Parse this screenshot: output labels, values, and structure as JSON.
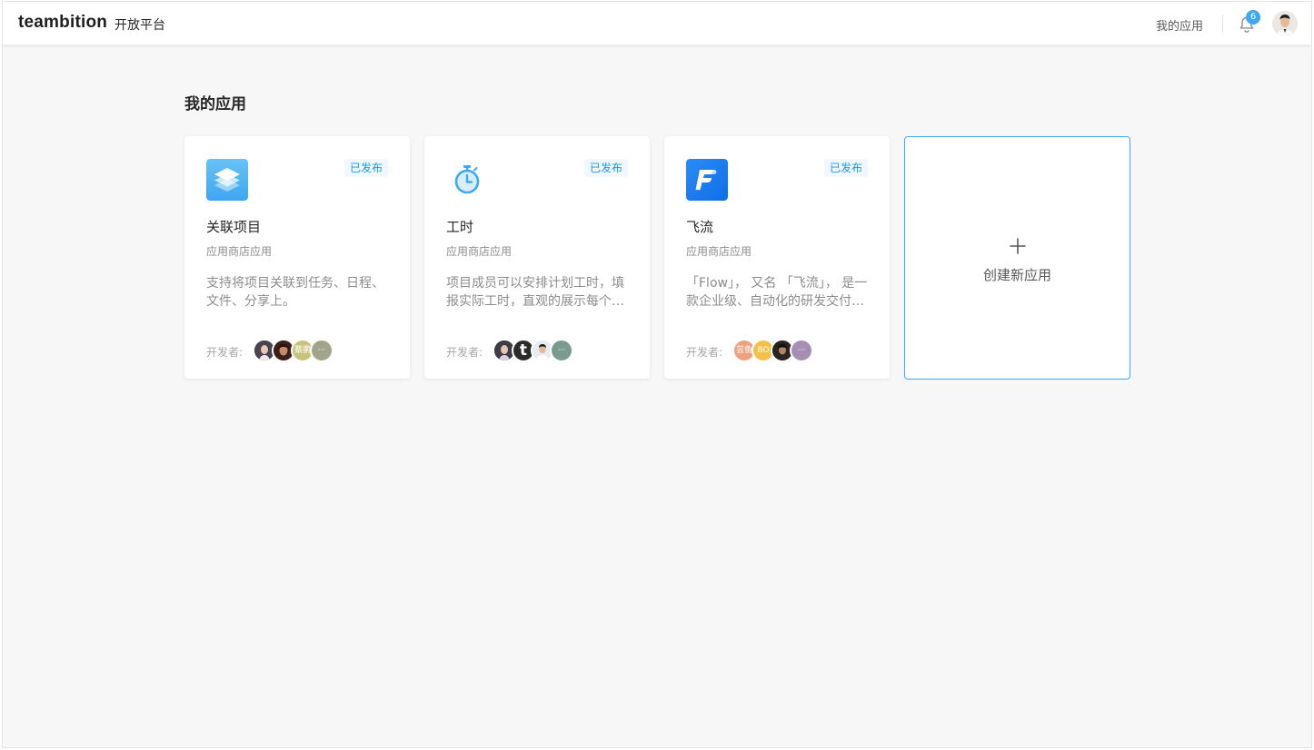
{
  "header": {
    "brand": "teambition",
    "brand_sub": "开放平台",
    "nav_my_apps": "我的应用",
    "notification_count": "6",
    "icons": {
      "bell": "bell-icon",
      "user": "user-avatar"
    }
  },
  "main": {
    "title": "我的应用",
    "dev_label": "开发者:",
    "cards": [
      {
        "icon": "layers-icon",
        "status": "已发布",
        "name": "关联项目",
        "type": "应用商店应用",
        "desc": "支持将项目关联到任务、日程、文件、分享上。",
        "devs": [
          {
            "text": "",
            "color": "#4a4350"
          },
          {
            "text": "",
            "color": "#7a3b2e"
          },
          {
            "text": "蔡鹏",
            "color": "#c7c37a"
          },
          {
            "text": "···",
            "color": "#a3a58b"
          }
        ]
      },
      {
        "icon": "stopwatch-icon",
        "status": "已发布",
        "name": "工时",
        "type": "应用商店应用",
        "desc": "项目成员可以安排计划工时，填报实际工时，直观的展示每个成员的工作情况。",
        "devs": [
          {
            "text": "",
            "color": "#3f3c48"
          },
          {
            "text": "t",
            "color": "#2b2b2b"
          },
          {
            "text": "",
            "color": "#d9e2ea"
          },
          {
            "text": "···",
            "color": "#7a9a92"
          }
        ]
      },
      {
        "icon": "flow-icon",
        "status": "已发布",
        "name": "飞流",
        "type": "应用商店应用",
        "desc": "「Flow」， 又名 「飞流」， 是一款企业级、自动化的研发交付流水线。",
        "devs": [
          {
            "text": "芸鱼",
            "color": "#f0a07c"
          },
          {
            "text": "BO",
            "color": "#f3c14b"
          },
          {
            "text": "",
            "color": "#3a2e26"
          },
          {
            "text": "···",
            "color": "#a68fb3"
          }
        ]
      }
    ],
    "create_label": "创建新应用",
    "colors": {
      "accent": "#3da8f5",
      "status_text": "#1b9aee"
    }
  }
}
